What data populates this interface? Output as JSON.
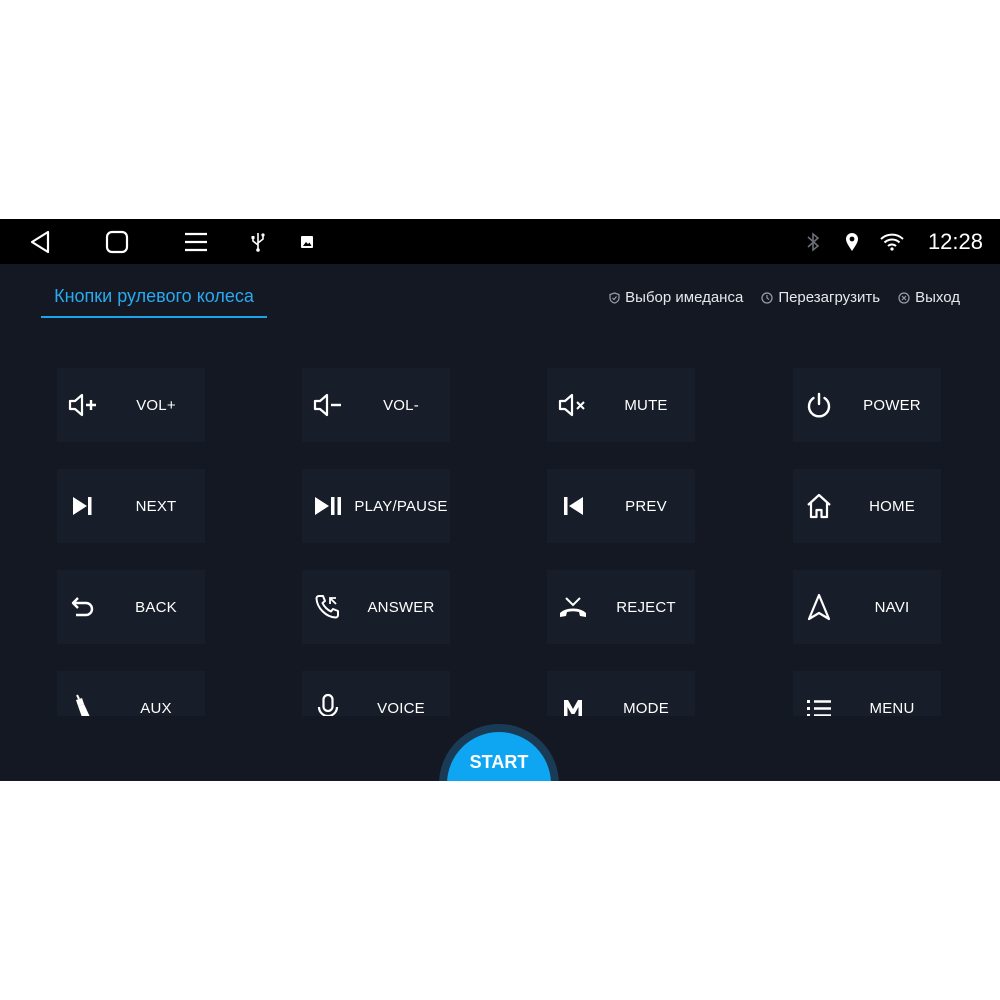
{
  "statusbar": {
    "nav": [
      {
        "name": "back-nav-icon"
      },
      {
        "name": "home-nav-icon"
      },
      {
        "name": "recents-nav-icon"
      }
    ],
    "notifications": [
      "usb-icon",
      "image-icon"
    ],
    "system": [
      "bluetooth-icon",
      "location-icon",
      "wifi-icon"
    ],
    "time": "12:28"
  },
  "header": {
    "tab_label": "Кнопки рулевого колеса",
    "actions": [
      {
        "label": "Выбор имеданса",
        "icon": "shield-icon"
      },
      {
        "label": "Перезагрузить",
        "icon": "reset-clock-icon"
      },
      {
        "label": "Выход",
        "icon": "close-circle-icon"
      }
    ]
  },
  "buttons": [
    {
      "label": "VOL+",
      "icon": "volume-up-icon"
    },
    {
      "label": "VOL-",
      "icon": "volume-down-icon"
    },
    {
      "label": "MUTE",
      "icon": "mute-icon"
    },
    {
      "label": "POWER",
      "icon": "power-icon"
    },
    {
      "label": "NEXT",
      "icon": "skip-next-icon"
    },
    {
      "label": "PLAY/PAUSE",
      "icon": "play-pause-icon"
    },
    {
      "label": "PREV",
      "icon": "skip-previous-icon"
    },
    {
      "label": "HOME",
      "icon": "home-icon"
    },
    {
      "label": "BACK",
      "icon": "undo-arrow-icon"
    },
    {
      "label": "ANSWER",
      "icon": "phone-answer-icon"
    },
    {
      "label": "REJECT",
      "icon": "phone-reject-icon"
    },
    {
      "label": "NAVI",
      "icon": "navigation-arrow-icon"
    },
    {
      "label": "AUX",
      "icon": "aux-plug-icon"
    },
    {
      "label": "VOICE",
      "icon": "microphone-icon"
    },
    {
      "label": "MODE",
      "icon": "mode-m-icon"
    },
    {
      "label": "MENU",
      "icon": "menu-list-icon"
    }
  ],
  "start_label": "START",
  "colors": {
    "accent": "#1ea3ea",
    "start_button": "#0ea6f2",
    "background": "#131822",
    "button_bg": "#181e29"
  }
}
